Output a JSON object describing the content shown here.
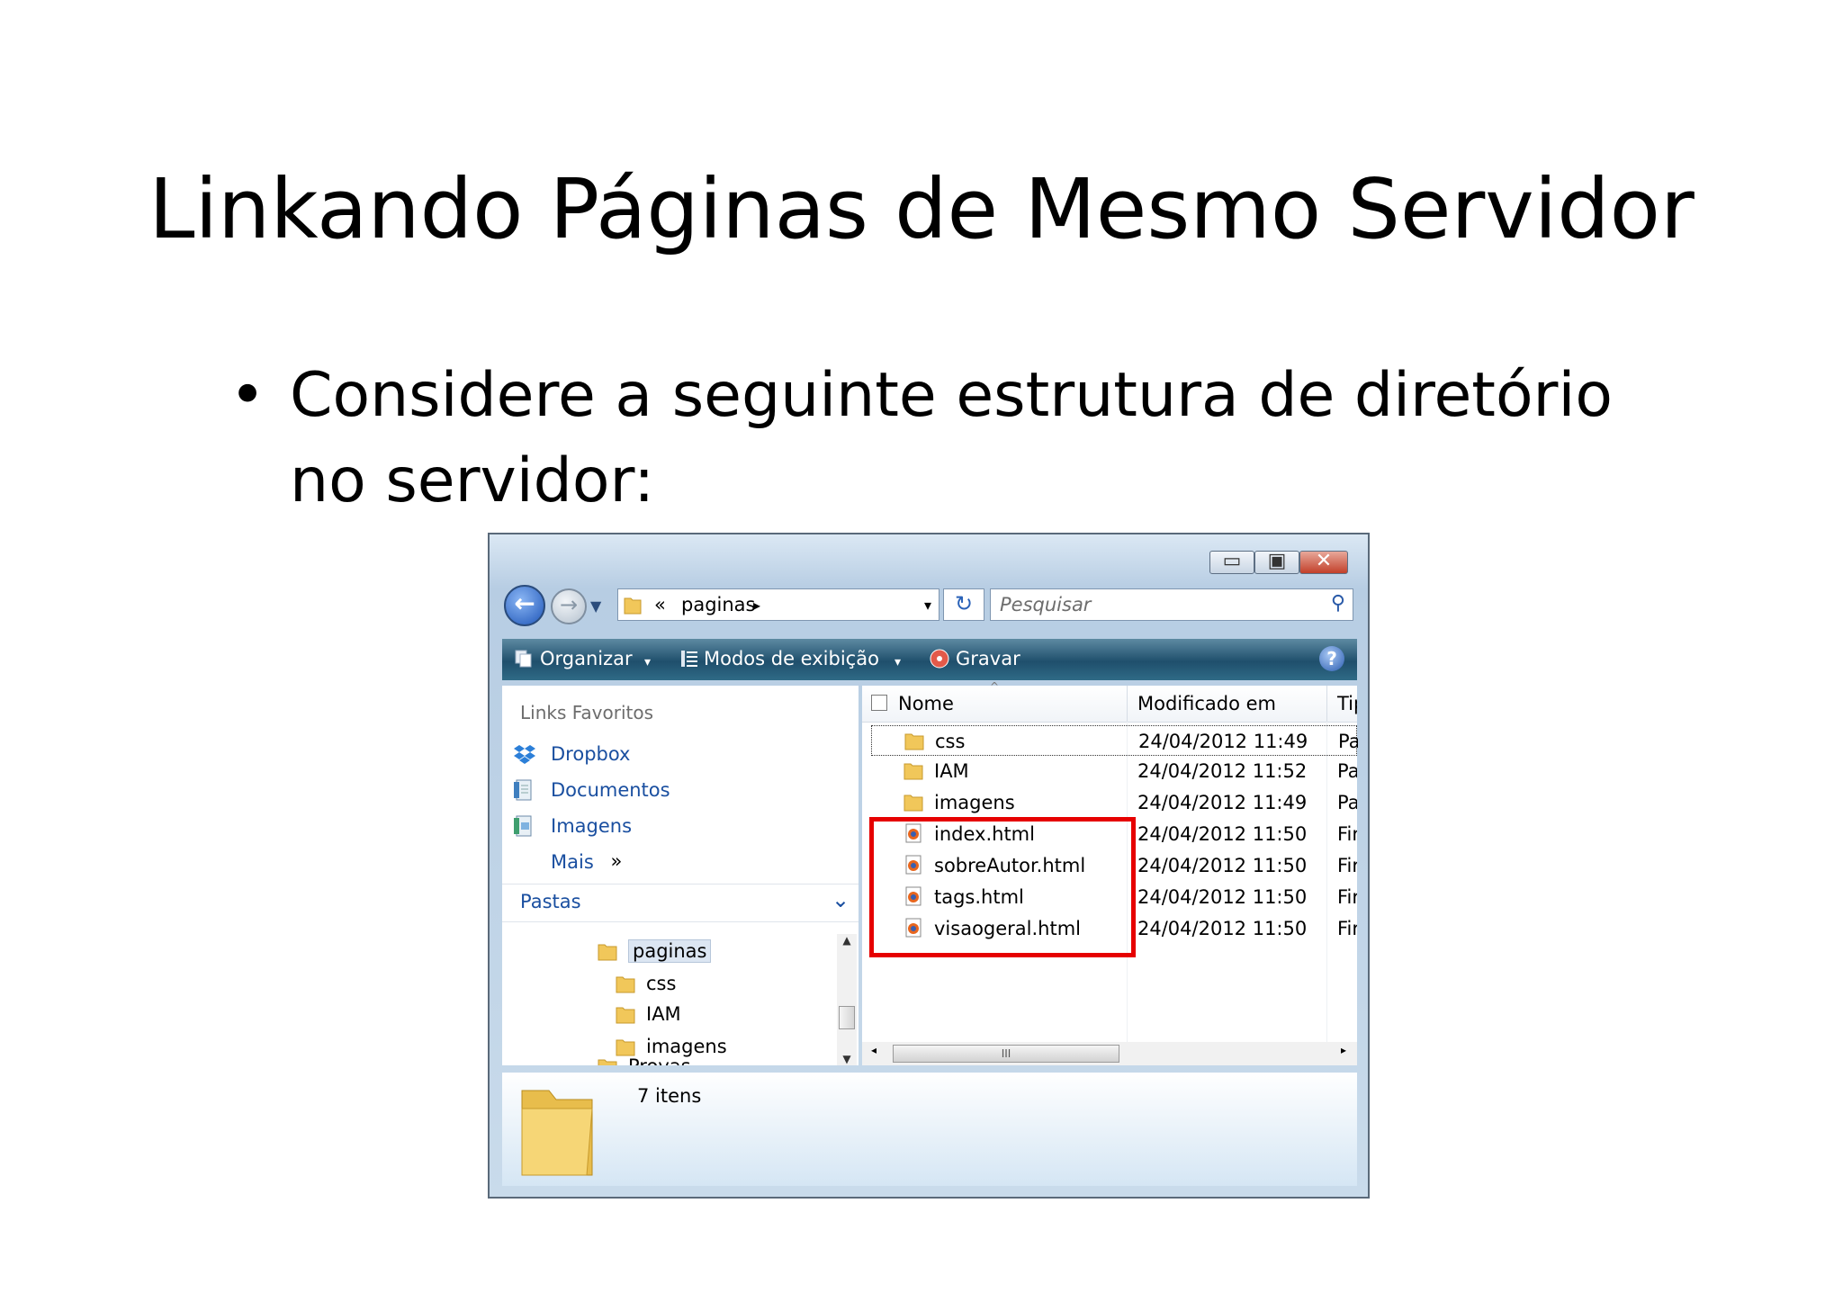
{
  "slide": {
    "title": "Linkando Páginas de Mesmo Servidor",
    "bullet_marker": "•",
    "bullet_text": "Considere a seguinte estrutura de diretório no servidor:"
  },
  "window": {
    "controls": {
      "minimize": "▭",
      "maximize": "▣",
      "close": "✕"
    },
    "address": {
      "prefix": "«",
      "path": "paginas",
      "arrow": "▸",
      "dropdown": "▾"
    },
    "search_placeholder": "Pesquisar",
    "toolbar": {
      "organize": "Organizar",
      "organize_arrow": "▾",
      "views": "Modos de exibição",
      "views_arrow": "▾",
      "burn": "Gravar",
      "help": "?"
    },
    "navigation": {
      "favorites_header": "Links Favoritos",
      "favorites": [
        {
          "label": "Dropbox",
          "icon": "dropbox-icon"
        },
        {
          "label": "Documentos",
          "icon": "documents-icon"
        },
        {
          "label": "Imagens",
          "icon": "images-icon"
        }
      ],
      "more": "Mais",
      "more_arrow": "»",
      "folders_header": "Pastas",
      "folders_chevron": "⌄",
      "tree": [
        {
          "label": "paginas",
          "selected": true
        },
        {
          "label": "css"
        },
        {
          "label": "IAM"
        },
        {
          "label": "imagens"
        },
        {
          "label": "Provas"
        }
      ]
    },
    "file_list": {
      "columns": [
        "Nome",
        "Modificado em",
        "Tipo"
      ],
      "rows": [
        {
          "name": "css",
          "modified": "24/04/2012 11:49",
          "type": "Pasta de arquivos",
          "kind": "folder"
        },
        {
          "name": "IAM",
          "modified": "24/04/2012 11:52",
          "type": "Pasta de arquivos",
          "kind": "folder"
        },
        {
          "name": "imagens",
          "modified": "24/04/2012 11:49",
          "type": "Pasta de arquivos",
          "kind": "folder"
        },
        {
          "name": "index.html",
          "modified": "24/04/2012 11:50",
          "type": "Firefox HTML",
          "kind": "html"
        },
        {
          "name": "sobreAutor.html",
          "modified": "24/04/2012 11:50",
          "type": "Firefox HTML",
          "kind": "html"
        },
        {
          "name": "tags.html",
          "modified": "24/04/2012 11:50",
          "type": "Firefox HTML",
          "kind": "html"
        },
        {
          "name": "visaogeral.html",
          "modified": "24/04/2012 11:50",
          "type": "Firefox HTML",
          "kind": "html"
        }
      ],
      "scroll_grip": "III",
      "scroll_left": "◂",
      "scroll_right": "▸"
    },
    "status": {
      "item_count": "7 itens"
    }
  }
}
